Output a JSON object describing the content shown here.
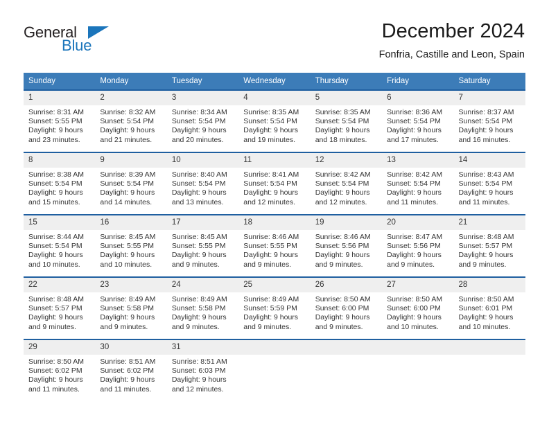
{
  "brand": {
    "name_top": "General",
    "name_bottom": "Blue",
    "accent_color": "#1b75bb",
    "triangle_icon": "blue-triangle-icon"
  },
  "header": {
    "title": "December 2024",
    "subtitle": "Fonfria, Castille and Leon, Spain"
  },
  "theme": {
    "header_row_bg": "#3c7cb8",
    "cell_top_border": "#1f5fa0",
    "daynum_bg": "#efefef",
    "text": "#333333"
  },
  "calendar": {
    "weekday_headers": [
      "Sunday",
      "Monday",
      "Tuesday",
      "Wednesday",
      "Thursday",
      "Friday",
      "Saturday"
    ],
    "weeks": [
      [
        {
          "day": "1",
          "sunrise": "Sunrise: 8:31 AM",
          "sunset": "Sunset: 5:55 PM",
          "daylight_line1": "Daylight: 9 hours",
          "daylight_line2": "and 23 minutes."
        },
        {
          "day": "2",
          "sunrise": "Sunrise: 8:32 AM",
          "sunset": "Sunset: 5:54 PM",
          "daylight_line1": "Daylight: 9 hours",
          "daylight_line2": "and 21 minutes."
        },
        {
          "day": "3",
          "sunrise": "Sunrise: 8:34 AM",
          "sunset": "Sunset: 5:54 PM",
          "daylight_line1": "Daylight: 9 hours",
          "daylight_line2": "and 20 minutes."
        },
        {
          "day": "4",
          "sunrise": "Sunrise: 8:35 AM",
          "sunset": "Sunset: 5:54 PM",
          "daylight_line1": "Daylight: 9 hours",
          "daylight_line2": "and 19 minutes."
        },
        {
          "day": "5",
          "sunrise": "Sunrise: 8:35 AM",
          "sunset": "Sunset: 5:54 PM",
          "daylight_line1": "Daylight: 9 hours",
          "daylight_line2": "and 18 minutes."
        },
        {
          "day": "6",
          "sunrise": "Sunrise: 8:36 AM",
          "sunset": "Sunset: 5:54 PM",
          "daylight_line1": "Daylight: 9 hours",
          "daylight_line2": "and 17 minutes."
        },
        {
          "day": "7",
          "sunrise": "Sunrise: 8:37 AM",
          "sunset": "Sunset: 5:54 PM",
          "daylight_line1": "Daylight: 9 hours",
          "daylight_line2": "and 16 minutes."
        }
      ],
      [
        {
          "day": "8",
          "sunrise": "Sunrise: 8:38 AM",
          "sunset": "Sunset: 5:54 PM",
          "daylight_line1": "Daylight: 9 hours",
          "daylight_line2": "and 15 minutes."
        },
        {
          "day": "9",
          "sunrise": "Sunrise: 8:39 AM",
          "sunset": "Sunset: 5:54 PM",
          "daylight_line1": "Daylight: 9 hours",
          "daylight_line2": "and 14 minutes."
        },
        {
          "day": "10",
          "sunrise": "Sunrise: 8:40 AM",
          "sunset": "Sunset: 5:54 PM",
          "daylight_line1": "Daylight: 9 hours",
          "daylight_line2": "and 13 minutes."
        },
        {
          "day": "11",
          "sunrise": "Sunrise: 8:41 AM",
          "sunset": "Sunset: 5:54 PM",
          "daylight_line1": "Daylight: 9 hours",
          "daylight_line2": "and 12 minutes."
        },
        {
          "day": "12",
          "sunrise": "Sunrise: 8:42 AM",
          "sunset": "Sunset: 5:54 PM",
          "daylight_line1": "Daylight: 9 hours",
          "daylight_line2": "and 12 minutes."
        },
        {
          "day": "13",
          "sunrise": "Sunrise: 8:42 AM",
          "sunset": "Sunset: 5:54 PM",
          "daylight_line1": "Daylight: 9 hours",
          "daylight_line2": "and 11 minutes."
        },
        {
          "day": "14",
          "sunrise": "Sunrise: 8:43 AM",
          "sunset": "Sunset: 5:54 PM",
          "daylight_line1": "Daylight: 9 hours",
          "daylight_line2": "and 11 minutes."
        }
      ],
      [
        {
          "day": "15",
          "sunrise": "Sunrise: 8:44 AM",
          "sunset": "Sunset: 5:54 PM",
          "daylight_line1": "Daylight: 9 hours",
          "daylight_line2": "and 10 minutes."
        },
        {
          "day": "16",
          "sunrise": "Sunrise: 8:45 AM",
          "sunset": "Sunset: 5:55 PM",
          "daylight_line1": "Daylight: 9 hours",
          "daylight_line2": "and 10 minutes."
        },
        {
          "day": "17",
          "sunrise": "Sunrise: 8:45 AM",
          "sunset": "Sunset: 5:55 PM",
          "daylight_line1": "Daylight: 9 hours",
          "daylight_line2": "and 9 minutes."
        },
        {
          "day": "18",
          "sunrise": "Sunrise: 8:46 AM",
          "sunset": "Sunset: 5:55 PM",
          "daylight_line1": "Daylight: 9 hours",
          "daylight_line2": "and 9 minutes."
        },
        {
          "day": "19",
          "sunrise": "Sunrise: 8:46 AM",
          "sunset": "Sunset: 5:56 PM",
          "daylight_line1": "Daylight: 9 hours",
          "daylight_line2": "and 9 minutes."
        },
        {
          "day": "20",
          "sunrise": "Sunrise: 8:47 AM",
          "sunset": "Sunset: 5:56 PM",
          "daylight_line1": "Daylight: 9 hours",
          "daylight_line2": "and 9 minutes."
        },
        {
          "day": "21",
          "sunrise": "Sunrise: 8:48 AM",
          "sunset": "Sunset: 5:57 PM",
          "daylight_line1": "Daylight: 9 hours",
          "daylight_line2": "and 9 minutes."
        }
      ],
      [
        {
          "day": "22",
          "sunrise": "Sunrise: 8:48 AM",
          "sunset": "Sunset: 5:57 PM",
          "daylight_line1": "Daylight: 9 hours",
          "daylight_line2": "and 9 minutes."
        },
        {
          "day": "23",
          "sunrise": "Sunrise: 8:49 AM",
          "sunset": "Sunset: 5:58 PM",
          "daylight_line1": "Daylight: 9 hours",
          "daylight_line2": "and 9 minutes."
        },
        {
          "day": "24",
          "sunrise": "Sunrise: 8:49 AM",
          "sunset": "Sunset: 5:58 PM",
          "daylight_line1": "Daylight: 9 hours",
          "daylight_line2": "and 9 minutes."
        },
        {
          "day": "25",
          "sunrise": "Sunrise: 8:49 AM",
          "sunset": "Sunset: 5:59 PM",
          "daylight_line1": "Daylight: 9 hours",
          "daylight_line2": "and 9 minutes."
        },
        {
          "day": "26",
          "sunrise": "Sunrise: 8:50 AM",
          "sunset": "Sunset: 6:00 PM",
          "daylight_line1": "Daylight: 9 hours",
          "daylight_line2": "and 9 minutes."
        },
        {
          "day": "27",
          "sunrise": "Sunrise: 8:50 AM",
          "sunset": "Sunset: 6:00 PM",
          "daylight_line1": "Daylight: 9 hours",
          "daylight_line2": "and 10 minutes."
        },
        {
          "day": "28",
          "sunrise": "Sunrise: 8:50 AM",
          "sunset": "Sunset: 6:01 PM",
          "daylight_line1": "Daylight: 9 hours",
          "daylight_line2": "and 10 minutes."
        }
      ],
      [
        {
          "day": "29",
          "sunrise": "Sunrise: 8:50 AM",
          "sunset": "Sunset: 6:02 PM",
          "daylight_line1": "Daylight: 9 hours",
          "daylight_line2": "and 11 minutes."
        },
        {
          "day": "30",
          "sunrise": "Sunrise: 8:51 AM",
          "sunset": "Sunset: 6:02 PM",
          "daylight_line1": "Daylight: 9 hours",
          "daylight_line2": "and 11 minutes."
        },
        {
          "day": "31",
          "sunrise": "Sunrise: 8:51 AM",
          "sunset": "Sunset: 6:03 PM",
          "daylight_line1": "Daylight: 9 hours",
          "daylight_line2": "and 12 minutes."
        },
        {
          "day": "",
          "sunrise": "",
          "sunset": "",
          "daylight_line1": "",
          "daylight_line2": ""
        },
        {
          "day": "",
          "sunrise": "",
          "sunset": "",
          "daylight_line1": "",
          "daylight_line2": ""
        },
        {
          "day": "",
          "sunrise": "",
          "sunset": "",
          "daylight_line1": "",
          "daylight_line2": ""
        },
        {
          "day": "",
          "sunrise": "",
          "sunset": "",
          "daylight_line1": "",
          "daylight_line2": ""
        }
      ]
    ]
  }
}
